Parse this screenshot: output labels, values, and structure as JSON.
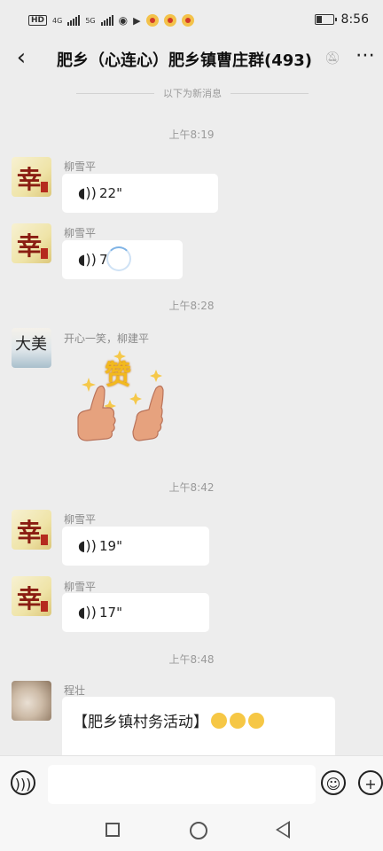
{
  "status_bar": {
    "network_left": "HD",
    "sim1": "4G",
    "sim2": "5G",
    "time": "8:56"
  },
  "header": {
    "title": "肥乡（心连心）肥乡镇曹庄群(493)",
    "back_icon": "chevron-left-icon",
    "mute_icon": "bell-off-icon",
    "more_icon": "more-dots-icon"
  },
  "new_messages_divider": "以下为新消息",
  "timestamps": [
    "上午8:19",
    "上午8:28",
    "上午8:42",
    "上午8:48"
  ],
  "messages": [
    {
      "sender": "柳雪平",
      "type": "voice",
      "duration": "22\""
    },
    {
      "sender": "柳雪平",
      "type": "voice",
      "duration": "7"
    },
    {
      "sender": "开心一笑，柳建平",
      "type": "sticker",
      "sticker_text": "赞"
    },
    {
      "sender": "柳雪平",
      "type": "voice",
      "duration": "19\""
    },
    {
      "sender": "柳雪平",
      "type": "voice",
      "duration": "17\""
    },
    {
      "sender": "程壮",
      "type": "text",
      "text": "【肥乡镇村务活动】",
      "text_partial": "..."
    }
  ],
  "avatar_text": {
    "gold": "幸",
    "ink": "大美"
  },
  "colors": {
    "background": "#ededed",
    "bubble": "#ffffff",
    "accent_gold": "#efe4a8",
    "seal_red": "#b52a1e"
  },
  "input_bar": {
    "voice_icon": "voice-icon",
    "emoji_icon": "emoji-icon",
    "add_icon": "plus-icon"
  },
  "nav": {
    "recent": "square-icon",
    "home": "circle-icon",
    "back": "triangle-back-icon"
  }
}
